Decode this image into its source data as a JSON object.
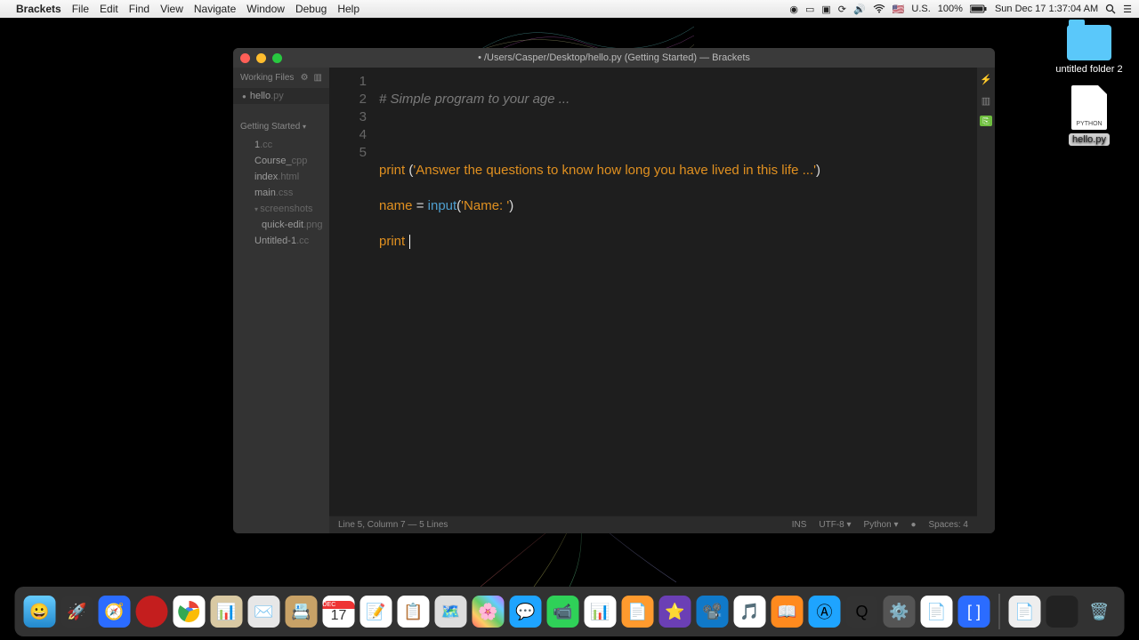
{
  "menubar": {
    "app": "Brackets",
    "items": [
      "File",
      "Edit",
      "Find",
      "View",
      "Navigate",
      "Window",
      "Debug",
      "Help"
    ],
    "locale": "U.S.",
    "battery": "100%",
    "clock": "Sun Dec 17  1:37:04 AM"
  },
  "desktop": {
    "folder_label": "untitled folder 2",
    "file_label": "hello.py",
    "file_badge": "PYTHON"
  },
  "window": {
    "title": "• /Users/Casper/Desktop/hello.py (Getting Started) — Brackets"
  },
  "sidebar": {
    "working_header": "Working Files",
    "working_items": [
      {
        "name": "hello",
        "ext": ".py",
        "dirty": true
      }
    ],
    "project_header": "Getting Started",
    "project_items": [
      {
        "name": "1",
        "ext": ".cc"
      },
      {
        "name": "Course_",
        "ext": "cpp"
      },
      {
        "name": "index",
        "ext": ".html"
      },
      {
        "name": "main",
        "ext": ".css"
      }
    ],
    "folder": {
      "name": "screenshots",
      "children": [
        {
          "name": "quick-edit",
          "ext": ".png"
        }
      ]
    },
    "tail_items": [
      {
        "name": "Untitled-1",
        "ext": ".cc"
      }
    ]
  },
  "code": {
    "lines": [
      "1",
      "2",
      "3",
      "4",
      "5"
    ],
    "l1_comment": "# Simple program to your age ...",
    "l3_print": "print",
    "l3_str": "'Answer the questions to know how long you have lived in this life ...'",
    "l4_name": "name",
    "l4_eq": " = ",
    "l4_input": "input",
    "l4_arg": "'Name: '",
    "l5_print": "print"
  },
  "status": {
    "left": "Line 5, Column 7 — 5 Lines",
    "ins": "INS",
    "enc": "UTF-8 ▾",
    "lang": "Python ▾",
    "err": "●",
    "spaces": "Spaces: 4"
  },
  "dock": {
    "cal_month": "DEC",
    "cal_day": "17"
  }
}
